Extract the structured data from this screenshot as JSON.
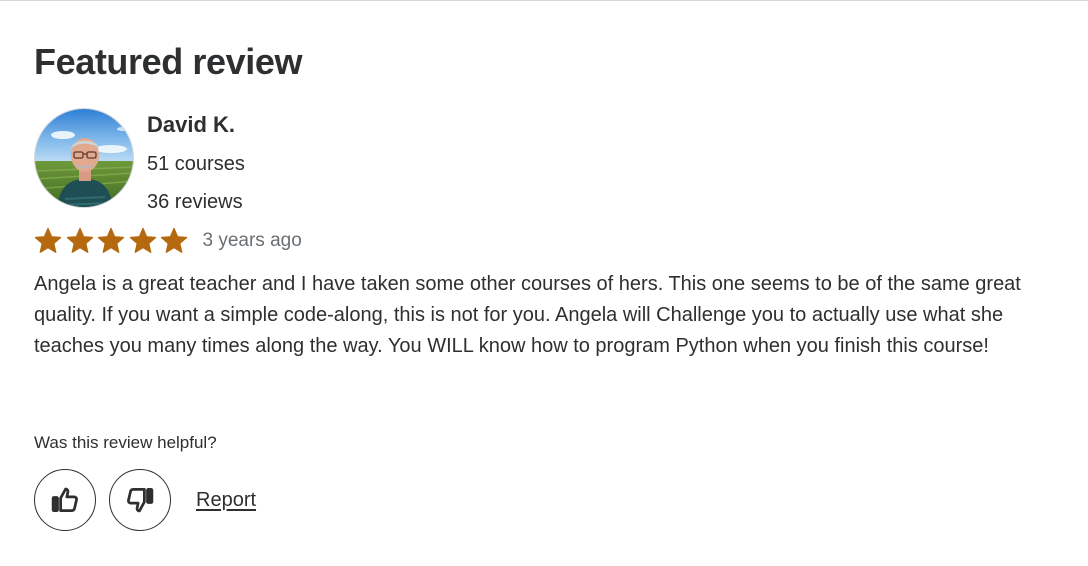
{
  "section": {
    "title": "Featured review"
  },
  "reviewer": {
    "name": "David K.",
    "courses": "51 courses",
    "reviews": "36 reviews",
    "avatar_icon": "user-photo-avatar"
  },
  "review": {
    "rating": 5,
    "rating_max": 5,
    "star_color": "#b4690e",
    "date": "3 years ago",
    "body": "Angela is a great teacher and I have taken some other courses of hers. This one seems to be of the same great quality. If you want a simple code-along, this is not for you. Angela will Challenge you to actually use what she teaches you many times along the way. You WILL know how to program Python when you finish this course!"
  },
  "feedback": {
    "prompt": "Was this review helpful?",
    "like_icon": "thumbs-up-icon",
    "dislike_icon": "thumbs-down-icon",
    "report_label": "Report"
  }
}
